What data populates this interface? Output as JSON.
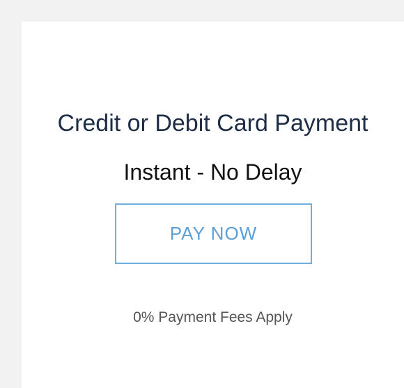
{
  "payment_card": {
    "title": "Credit or Debit Card Payment",
    "subtitle": "Instant - No Delay",
    "pay_button_label": "PAY NOW",
    "fees_note": "0% Payment Fees Apply"
  },
  "colors": {
    "title_text": "#1e2d45",
    "button_border": "#70aee0",
    "button_text": "#5a9fd6",
    "page_background": "#f2f2f2",
    "card_background": "#ffffff"
  }
}
